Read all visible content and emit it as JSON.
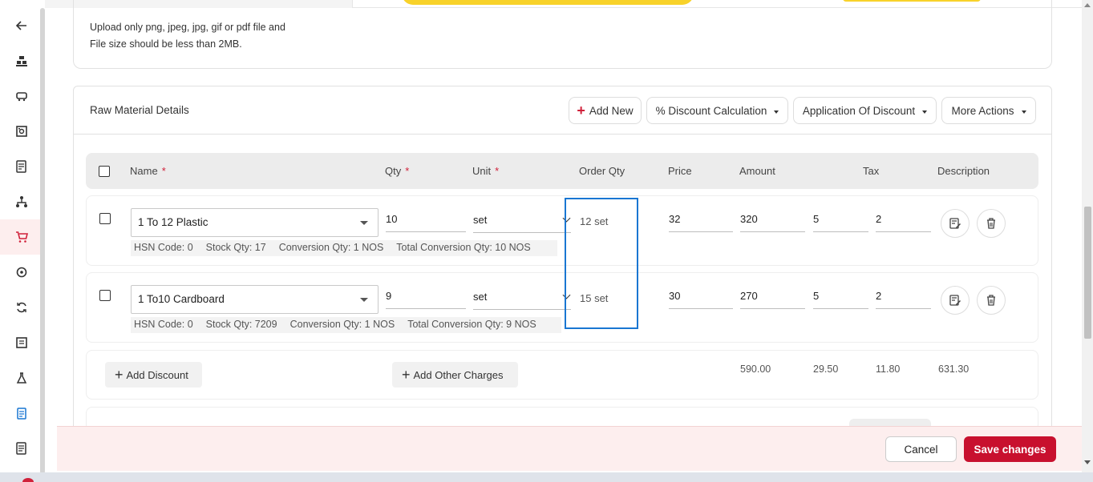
{
  "upload_note": {
    "line1": "Upload only png, jpeg, jpg, gif or pdf file and",
    "line2": "File size should be less than 2MB."
  },
  "sidebar": {
    "icons": [
      "back-arrow-icon",
      "warehouse-icon",
      "truck-icon",
      "register-icon",
      "report-icon",
      "network-icon",
      "cart-icon",
      "refresh-cycle-icon",
      "sync-icon",
      "document-icon",
      "flask-icon",
      "clipboard-icon",
      "invoice-icon"
    ],
    "active": "cart-icon",
    "accent": "#d0213a"
  },
  "raw_material": {
    "title": "Raw Material Details",
    "add_new": "Add New",
    "discount_calc": "% Discount Calculation",
    "application_discount": "Application Of Discount",
    "more_actions": "More Actions"
  },
  "table": {
    "headers": {
      "name": "Name",
      "qty": "Qty",
      "unit": "Unit",
      "order_qty": "Order Qty",
      "price": "Price",
      "amount": "Amount",
      "tax": "Tax",
      "description": "Description",
      "required_mark": "*"
    },
    "rows": [
      {
        "name": "1 To 12 Plastic",
        "qty": "10",
        "unit": "set",
        "order_qty": "12 set",
        "price": "32",
        "amount": "320",
        "tax": "5",
        "description": "2",
        "hsn": "HSN Code: 0",
        "stock": "Stock Qty: 17",
        "conversion": "Conversion Qty: 1 NOS",
        "total_conversion": "Total Conversion Qty: 10 NOS"
      },
      {
        "name": "1 To10 Cardboard",
        "qty": "9",
        "unit": "set",
        "order_qty": "15 set",
        "price": "30",
        "amount": "270",
        "tax": "5",
        "description": "2",
        "hsn": "HSN Code: 0",
        "stock": "Stock Qty: 7209",
        "conversion": "Conversion Qty: 1 NOS",
        "total_conversion": "Total Conversion Qty: 9 NOS"
      }
    ]
  },
  "totals": {
    "add_discount": "Add Discount",
    "add_other_charges": "Add Other Charges",
    "amount": "590.00",
    "tax": "29.50",
    "other": "11.80",
    "grand": "631.30"
  },
  "footer": {
    "cancel": "Cancel",
    "save": "Save changes"
  },
  "colors": {
    "primary": "#c8102e",
    "highlight_box": "#1976d2",
    "banner_yellow": "#f8d22a"
  }
}
